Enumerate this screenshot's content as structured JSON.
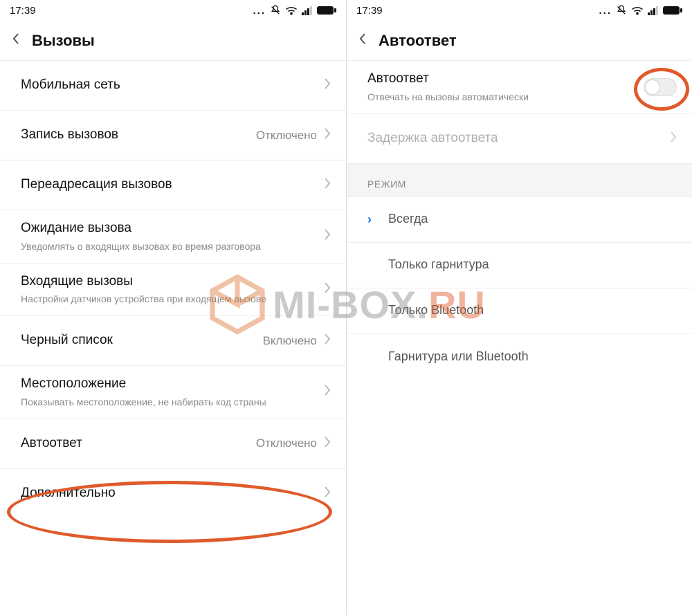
{
  "statusbar": {
    "time": "17:39"
  },
  "left": {
    "title": "Вызовы",
    "rows": [
      {
        "label": "Мобильная сеть",
        "value": "",
        "sub": ""
      },
      {
        "label": "Запись вызовов",
        "value": "Отключено",
        "sub": ""
      },
      {
        "label": "Переадресация вызовов",
        "value": "",
        "sub": ""
      },
      {
        "label": "Ожидание вызова",
        "value": "",
        "sub": "Уведомлять о входящих вызовах во время разговора"
      },
      {
        "label": "Входящие вызовы",
        "value": "",
        "sub": "Настройки датчиков устройства при входящем вызове"
      },
      {
        "label": "Черный список",
        "value": "Включено",
        "sub": ""
      },
      {
        "label": "Местоположение",
        "value": "",
        "sub": "Показывать местоположение, не набирать код страны"
      },
      {
        "label": "Автоответ",
        "value": "Отключено",
        "sub": ""
      },
      {
        "label": "Дополнительно",
        "value": "",
        "sub": ""
      }
    ]
  },
  "right": {
    "title": "Автоответ",
    "toggleRow": {
      "label": "Автоответ",
      "sub": "Отвечать на вызовы автоматически",
      "on": false
    },
    "delayRow": {
      "label": "Задержка автоответа"
    },
    "sectionHeader": "РЕЖИМ",
    "options": [
      {
        "label": "Всегда",
        "selected": true
      },
      {
        "label": "Только гарнитура",
        "selected": false
      },
      {
        "label": "Только Bluetooth",
        "selected": false
      },
      {
        "label": "Гарнитура или Bluetooth",
        "selected": false
      }
    ]
  },
  "watermark": {
    "text1": "MI-BOX",
    "dot": ".",
    "text2": "RU"
  }
}
